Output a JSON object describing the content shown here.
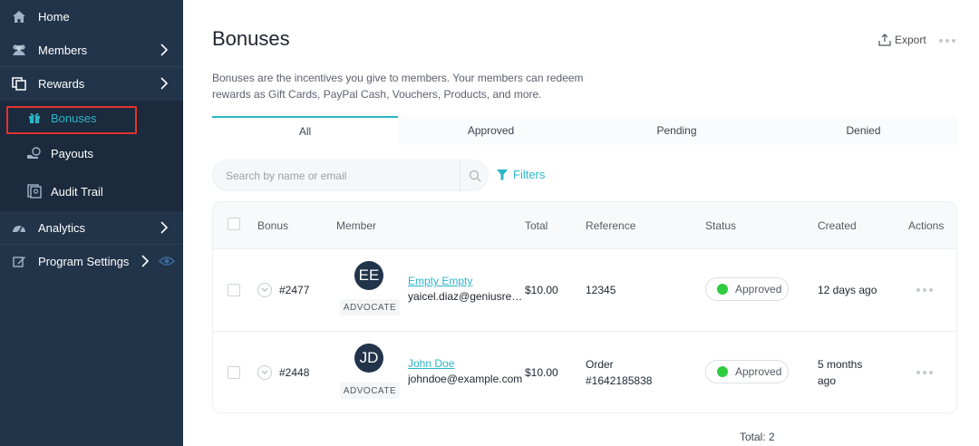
{
  "sidebar": {
    "items": [
      {
        "label": "Home",
        "icon": "home-icon"
      },
      {
        "label": "Members",
        "icon": "members-icon"
      },
      {
        "label": "Rewards",
        "icon": "rewards-icon"
      },
      {
        "label": "Bonuses",
        "icon": "gift-icon"
      },
      {
        "label": "Payouts",
        "icon": "payouts-icon"
      },
      {
        "label": "Audit Trail",
        "icon": "audit-trail-icon"
      },
      {
        "label": "Analytics",
        "icon": "analytics-icon"
      },
      {
        "label": "Program Settings",
        "icon": "settings-edit-icon"
      }
    ],
    "active_item": "Bonuses"
  },
  "header": {
    "title": "Bonuses",
    "export_label": "Export",
    "description": "Bonuses are the incentives you give to members. Your members can redeem rewards as Gift Cards, PayPal Cash, Vouchers, Products, and more."
  },
  "tabs": [
    {
      "label": "All",
      "active": true
    },
    {
      "label": "Approved",
      "active": false
    },
    {
      "label": "Pending",
      "active": false
    },
    {
      "label": "Denied",
      "active": false
    }
  ],
  "search": {
    "placeholder": "Search by name or email"
  },
  "filters_label": "Filters",
  "table": {
    "columns": [
      "Bonus",
      "Member",
      "Total",
      "Reference",
      "Status",
      "Created",
      "Actions"
    ],
    "rows": [
      {
        "bonus": "#2477",
        "initials": "EE",
        "role": "ADVOCATE",
        "member_name": "Empty Empty",
        "member_email": "yaicel.diaz@geniusreferrals.com",
        "total": "$10.00",
        "reference_line1": "12345",
        "reference_line2": "",
        "status": "Approved",
        "created_line1": "12 days ago",
        "created_line2": ""
      },
      {
        "bonus": "#2448",
        "initials": "JD",
        "role": "ADVOCATE",
        "member_name": "John Doe",
        "member_email": "johndoe@example.com",
        "total": "$10.00",
        "reference_line1": "Order",
        "reference_line2": "#1642185838",
        "status": "Approved",
        "created_line1": "5 months",
        "created_line2": "ago"
      }
    ]
  },
  "total_label": "Total: 2",
  "colors": {
    "sidebar_bg": "#22344a",
    "accent": "#2bb5c9",
    "approved": "#2ecc40",
    "highlight": "#e2322b"
  }
}
